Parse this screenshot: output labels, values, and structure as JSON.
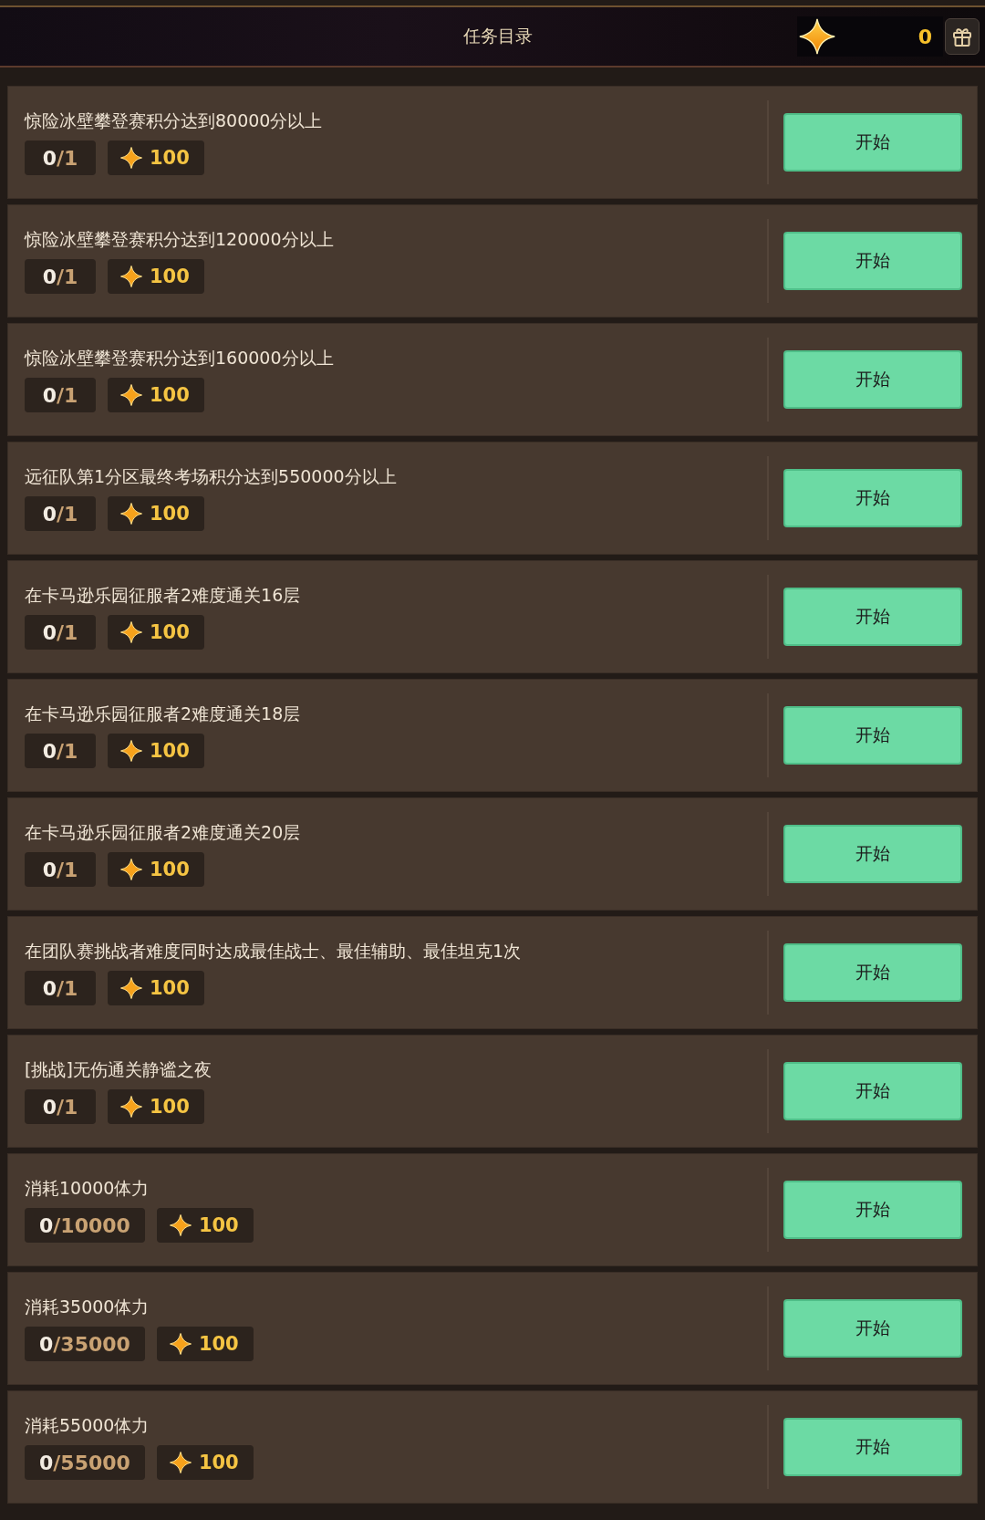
{
  "header": {
    "title": "任务目录",
    "currency": {
      "amount": "0"
    }
  },
  "tasks": [
    {
      "title": "惊险冰壁攀登赛积分达到80000分以上",
      "progress": {
        "done": "0",
        "total": "/1"
      },
      "reward": "100",
      "button": "开始"
    },
    {
      "title": "惊险冰壁攀登赛积分达到120000分以上",
      "progress": {
        "done": "0",
        "total": "/1"
      },
      "reward": "100",
      "button": "开始"
    },
    {
      "title": "惊险冰壁攀登赛积分达到160000分以上",
      "progress": {
        "done": "0",
        "total": "/1"
      },
      "reward": "100",
      "button": "开始"
    },
    {
      "title": "远征队第1分区最终考场积分达到550000分以上",
      "progress": {
        "done": "0",
        "total": "/1"
      },
      "reward": "100",
      "button": "开始"
    },
    {
      "title": "在卡马逊乐园征服者2难度通关16层",
      "progress": {
        "done": "0",
        "total": "/1"
      },
      "reward": "100",
      "button": "开始"
    },
    {
      "title": "在卡马逊乐园征服者2难度通关18层",
      "progress": {
        "done": "0",
        "total": "/1"
      },
      "reward": "100",
      "button": "开始"
    },
    {
      "title": "在卡马逊乐园征服者2难度通关20层",
      "progress": {
        "done": "0",
        "total": "/1"
      },
      "reward": "100",
      "button": "开始"
    },
    {
      "title": "在团队赛挑战者难度同时达成最佳战士、最佳辅助、最佳坦克1次",
      "progress": {
        "done": "0",
        "total": "/1"
      },
      "reward": "100",
      "button": "开始"
    },
    {
      "title": "[挑战]无伤通关静谧之夜",
      "progress": {
        "done": "0",
        "total": "/1"
      },
      "reward": "100",
      "button": "开始"
    },
    {
      "title": "消耗10000体力",
      "progress": {
        "done": "0",
        "total": "/10000"
      },
      "reward": "100",
      "button": "开始"
    },
    {
      "title": "消耗35000体力",
      "progress": {
        "done": "0",
        "total": "/35000"
      },
      "reward": "100",
      "button": "开始"
    },
    {
      "title": "消耗55000体力",
      "progress": {
        "done": "0",
        "total": "/55000"
      },
      "reward": "100",
      "button": "开始"
    }
  ]
}
